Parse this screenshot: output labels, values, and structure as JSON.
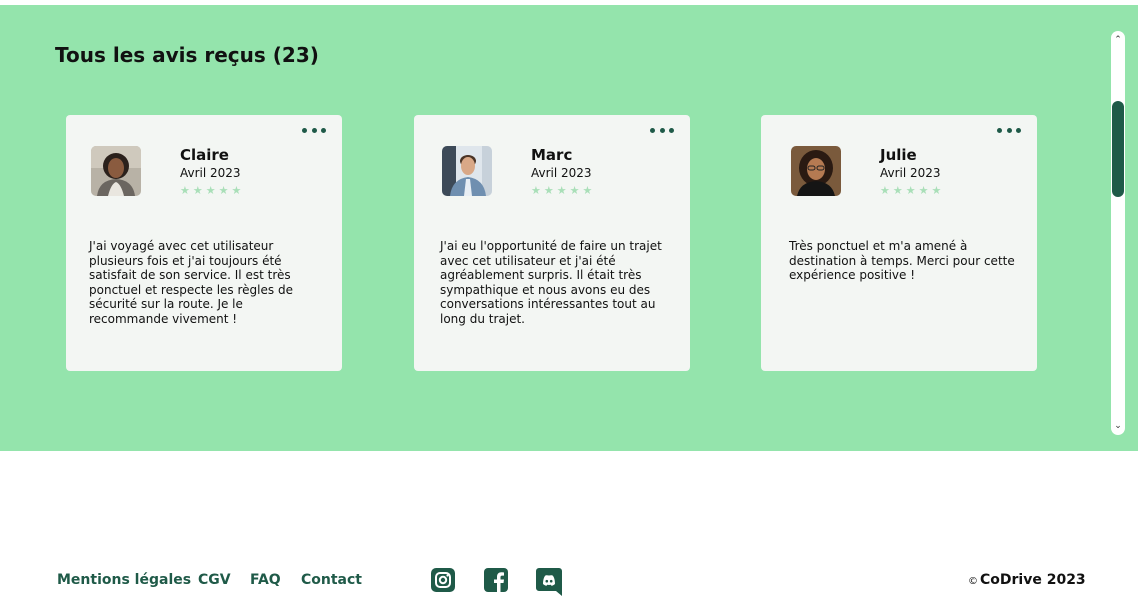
{
  "reviews": {
    "title": "Tous les avis reçus (23)",
    "cards": [
      {
        "name": "Claire",
        "date": "Avril 2023",
        "rating": 5,
        "stars": "★★★★★",
        "avatar_icon": "woman-portrait-photo",
        "text": "J'ai voyagé avec cet utilisateur plusieurs fois et j'ai toujours été satisfait de son service. Il est très ponctuel et respecte les règles de sécurité sur la route. Je le recommande vivement !"
      },
      {
        "name": "Marc",
        "date": "Avril 2023",
        "rating": 5,
        "stars": "★★★★★",
        "avatar_icon": "man-portrait-photo",
        "text": "J'ai eu l'opportunité de faire un trajet avec cet utilisateur et j'ai été agréablement surpris. Il était très sympathique et nous avons eu des conversations intéressantes tout au long du trajet."
      },
      {
        "name": "Julie",
        "date": "Avril 2023",
        "rating": 5,
        "stars": "★★★★★",
        "avatar_icon": "woman-portrait-photo",
        "text": "Très ponctuel et m'a amené à destination à temps. Merci pour cette expérience positive !"
      }
    ]
  },
  "footer": {
    "links": [
      "Mentions légales",
      "CGV",
      "FAQ",
      "Contact"
    ],
    "social_icons": [
      "instagram-icon",
      "facebook-icon",
      "discord-icon"
    ],
    "copyright_symbol": "©",
    "copyright": "CoDrive 2023"
  },
  "colors": {
    "section_bg": "#94e4ac",
    "card_bg": "#f3f6f3",
    "accent": "#1f5a48",
    "star": "#a9dfb8"
  }
}
